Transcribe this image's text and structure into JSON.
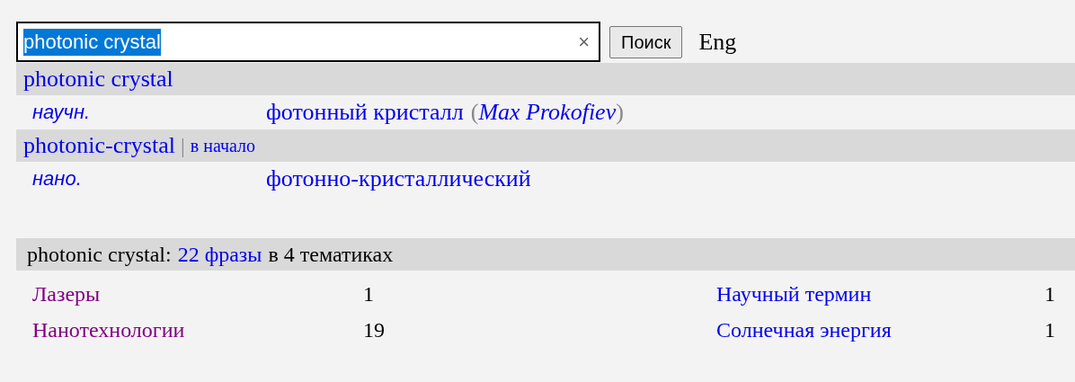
{
  "search": {
    "value": "photonic crystal",
    "value_selected": true,
    "clear": "×",
    "button": "Поиск",
    "language": "Eng"
  },
  "entries": [
    {
      "term": "photonic crystal",
      "meanings": [
        {
          "subject": "научн.",
          "translation": "фотонный кристалл",
          "author": "(*Max Prokofiev*)"
        }
      ]
    },
    {
      "term": "photonic-crystal",
      "extra": {
        "separator": "|",
        "link": "в начало"
      },
      "meanings": [
        {
          "subject": "нано.",
          "translation": "фотонно-кристаллический"
        }
      ]
    }
  ],
  "phrases": {
    "term": "photonic crystal:",
    "count_link": "22 фразы",
    "topics_text": "в 4 тематиках",
    "topics": [
      {
        "name": "Лазеры",
        "count": "1",
        "visited": true
      },
      {
        "name": "Научный термин",
        "count": "1",
        "visited": false
      },
      {
        "name": "Нанотехнологии",
        "count": "19",
        "visited": true
      },
      {
        "name": "Солнечная энергия",
        "count": "1",
        "visited": false
      }
    ]
  }
}
